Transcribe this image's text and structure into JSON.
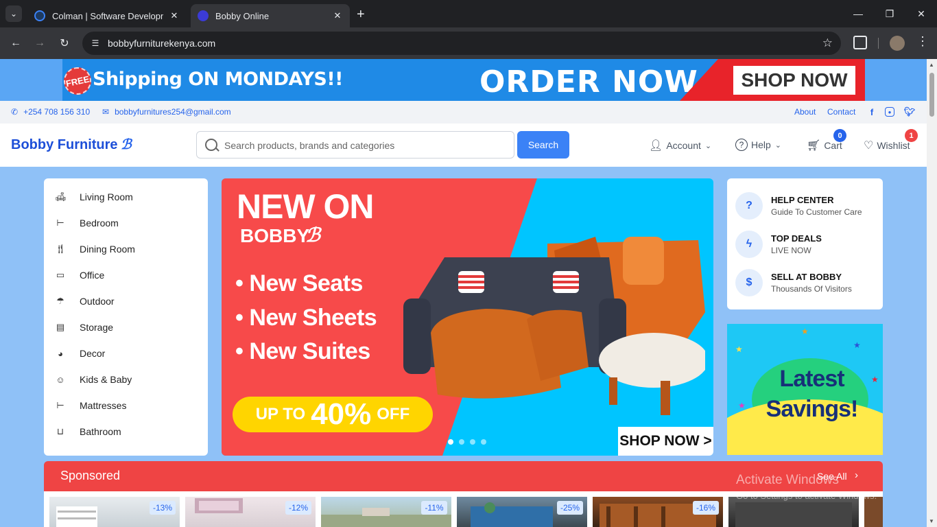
{
  "browser": {
    "tabs": [
      {
        "title": "Colman | Software Development",
        "favicon_color": "#1e3a5f"
      },
      {
        "title": "Bobby Online",
        "favicon_color": "#3b3bd6"
      }
    ],
    "url": "bobbyfurniturekenya.com"
  },
  "promo_banner": {
    "free": "FREE",
    "shipping": "Shipping ON MONDAYS!!",
    "order_now": "ORDER NOW",
    "shop_now": "SHOP NOW"
  },
  "topbar": {
    "phone": "+254 708 156 310",
    "email": "bobbyfurnitures254@gmail.com",
    "links": [
      "About",
      "Contact"
    ]
  },
  "header": {
    "brand": "Bobby Furniture",
    "search_placeholder": "Search products, brands and categories",
    "search_button": "Search",
    "account": "Account",
    "help": "Help",
    "cart": "Cart",
    "cart_count": "0",
    "wishlist": "Wishlist",
    "wishlist_count": "1"
  },
  "categories": [
    {
      "label": "Living Room",
      "icon": "sofa-icon"
    },
    {
      "label": "Bedroom",
      "icon": "bed-icon"
    },
    {
      "label": "Dining Room",
      "icon": "utensils-icon"
    },
    {
      "label": "Office",
      "icon": "laptop-icon"
    },
    {
      "label": "Outdoor",
      "icon": "umbrella-icon"
    },
    {
      "label": "Storage",
      "icon": "archive-icon"
    },
    {
      "label": "Decor",
      "icon": "palette-icon"
    },
    {
      "label": "Kids & Baby",
      "icon": "baby-icon"
    },
    {
      "label": "Mattresses",
      "icon": "mattress-icon"
    },
    {
      "label": "Bathroom",
      "icon": "bath-icon"
    }
  ],
  "hero": {
    "line1": "NEW ON",
    "line2": "BOBBY",
    "bullets": [
      "• New Seats",
      "• New Sheets",
      "• New Suites"
    ],
    "pill_a": "UP TO",
    "pill_b": "40%",
    "pill_c": "OFF",
    "shop": "SHOP NOW >",
    "slide_count": 4,
    "active_slide": 1
  },
  "right_panel": [
    {
      "title": "HELP CENTER",
      "subtitle": "Guide To Customer Care",
      "icon": "help-circle-icon"
    },
    {
      "title": "TOP DEALS",
      "subtitle": "LIVE NOW",
      "icon": "bolt-icon"
    },
    {
      "title": "SELL AT BOBBY",
      "subtitle": "Thousands Of Visitors",
      "icon": "dollar-icon"
    }
  ],
  "savings": {
    "line1": "Latest",
    "line2": "Savings!"
  },
  "sponsored": {
    "title": "Sponsored",
    "see_all": "See All",
    "discounts": [
      "-13%",
      "-12%",
      "-11%",
      "-25%",
      "-16%"
    ]
  },
  "os_watermark": {
    "line1": "Activate Windows",
    "line2": "Go to Settings to activate Windows."
  }
}
